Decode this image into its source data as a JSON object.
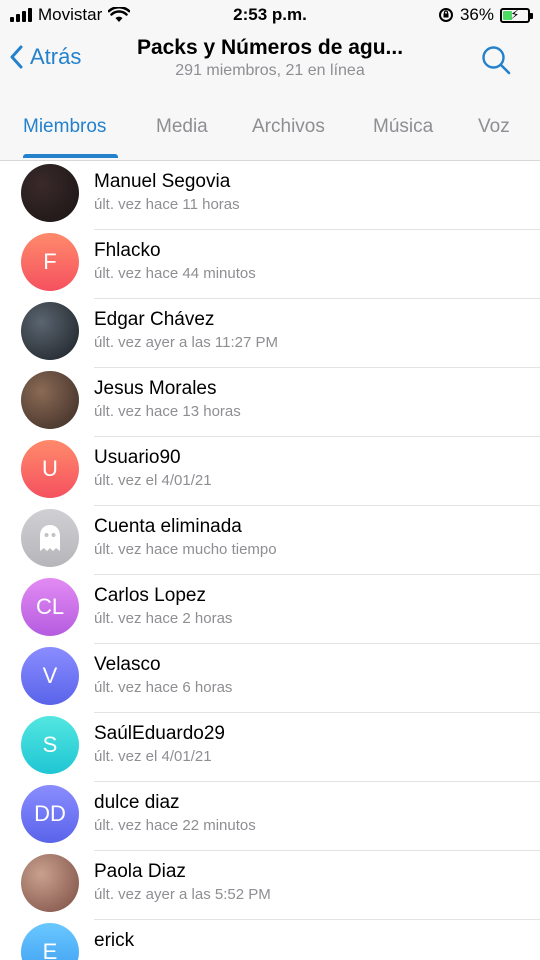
{
  "status_bar": {
    "carrier": "Movistar",
    "time": "2:53 p.m.",
    "battery": "36%",
    "battery_level": 0.36
  },
  "nav": {
    "back_label": "Atrás",
    "title": "Packs y Números de agu...",
    "subtitle": "291 miembros, 21 en línea"
  },
  "tabs": [
    "Miembros",
    "Media",
    "Archivos",
    "Música",
    "Voz"
  ],
  "active_tab": "Miembros",
  "members": [
    {
      "name": "Manuel Segovia",
      "status": "últ. vez hace 11 horas",
      "avatar_type": "photo",
      "initials": "",
      "colors": [
        "#3a2a2a",
        "#1a1414"
      ]
    },
    {
      "name": "Fhlacko",
      "status": "últ. vez hace 44 minutos",
      "avatar_type": "initials",
      "initials": "F",
      "colors": [
        "#ff8a6b",
        "#f5515f"
      ]
    },
    {
      "name": "Edgar Chávez",
      "status": "últ. vez ayer a las 11:27 PM",
      "avatar_type": "photo",
      "initials": "",
      "colors": [
        "#5a6570",
        "#1b1f24"
      ]
    },
    {
      "name": "Jesus Morales",
      "status": "últ. vez hace 13 horas",
      "avatar_type": "photo",
      "initials": "",
      "colors": [
        "#8a6a55",
        "#3a2a24"
      ]
    },
    {
      "name": "Usuario90",
      "status": "últ. vez el 4/01/21",
      "avatar_type": "initials",
      "initials": "U",
      "colors": [
        "#ff8a6b",
        "#f5515f"
      ]
    },
    {
      "name": "Cuenta eliminada",
      "status": "últ. vez hace mucho tiempo",
      "avatar_type": "ghost",
      "initials": "",
      "colors": [
        "#d0d0d4",
        "#b5b5ba"
      ]
    },
    {
      "name": "Carlos Lopez",
      "status": "últ. vez hace 2 horas",
      "avatar_type": "initials",
      "initials": "CL",
      "colors": [
        "#e38bf3",
        "#b55ce0"
      ]
    },
    {
      "name": "Velasco",
      "status": "últ. vez hace 6 horas",
      "avatar_type": "initials",
      "initials": "V",
      "colors": [
        "#8a8dff",
        "#5a64ea"
      ]
    },
    {
      "name": "SaúlEduardo29",
      "status": "últ. vez el 4/01/21",
      "avatar_type": "initials",
      "initials": "S",
      "colors": [
        "#53e6e0",
        "#1fc6d4"
      ]
    },
    {
      "name": "dulce diaz",
      "status": "últ. vez hace 22 minutos",
      "avatar_type": "initials",
      "initials": "DD",
      "colors": [
        "#8a8dff",
        "#5a64ea"
      ]
    },
    {
      "name": "Paola Diaz",
      "status": "últ. vez ayer a las 5:52 PM",
      "avatar_type": "photo",
      "initials": "",
      "colors": [
        "#c9a08e",
        "#7a4d42"
      ]
    },
    {
      "name": "erick",
      "status": "",
      "avatar_type": "initials",
      "initials": "E",
      "colors": [
        "#6ac8ff",
        "#3a9bf0"
      ]
    }
  ],
  "colors": {
    "accent": "#2481cc",
    "secondary_text": "#8e8e93",
    "bar_background": "#f7f7f7"
  }
}
